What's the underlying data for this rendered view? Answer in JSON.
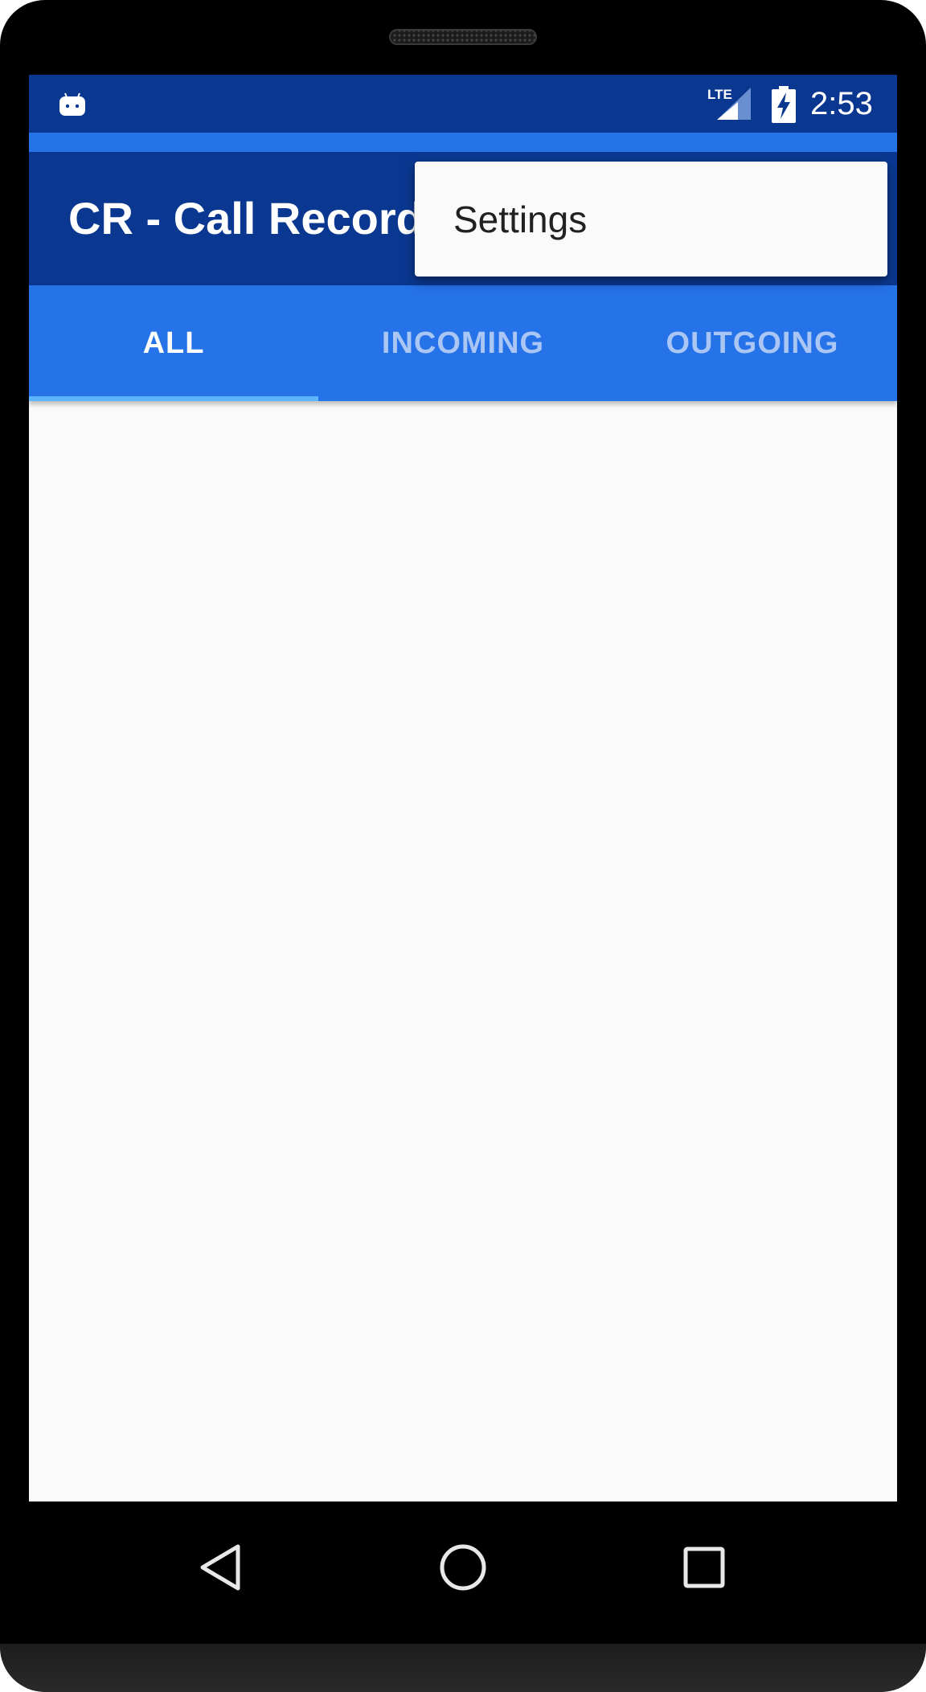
{
  "status_bar": {
    "time": "2:53",
    "icons": [
      "android-debug-icon",
      "lte-signal-icon",
      "battery-charging-icon"
    ]
  },
  "app_bar": {
    "title": "CR - Call Record"
  },
  "overflow_menu": {
    "items": [
      {
        "label": "Settings"
      }
    ]
  },
  "tabs": [
    {
      "label": "ALL",
      "active": true
    },
    {
      "label": "INCOMING",
      "active": false
    },
    {
      "label": "OUTGOING",
      "active": false
    }
  ],
  "navigation": {
    "icons": [
      "back-icon",
      "home-icon",
      "recents-icon"
    ]
  },
  "colors": {
    "primary_dark": "#0a3891",
    "primary": "#2672e8",
    "tab_indicator": "#5cb6ff",
    "background": "#fafafa"
  }
}
